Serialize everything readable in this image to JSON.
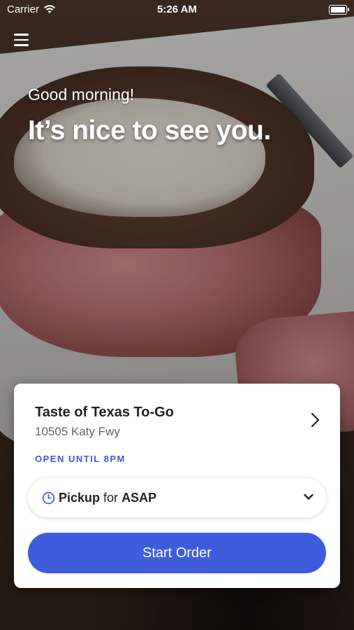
{
  "status_bar": {
    "carrier": "Carrier",
    "time": "5:26 AM"
  },
  "icons": {
    "menu": "hamburger-menu-icon",
    "wifi": "wifi-icon",
    "battery": "battery-icon",
    "chevron": "chevron-right-icon",
    "clock": "clock-icon",
    "dropdown": "chevron-down-icon"
  },
  "hero": {
    "greeting": "Good morning!",
    "headline": "It’s nice to see you."
  },
  "location_card": {
    "store_name": "Taste of Texas To-Go",
    "address": "10505 Katy Fwy",
    "open_status": "OPEN UNTIL 8PM",
    "order_type": "Pickup",
    "for_label": "for",
    "time_option": "ASAP",
    "start_button": "Start Order"
  },
  "colors": {
    "accent": "#3f5cdd",
    "open_status": "#3f59d8"
  }
}
